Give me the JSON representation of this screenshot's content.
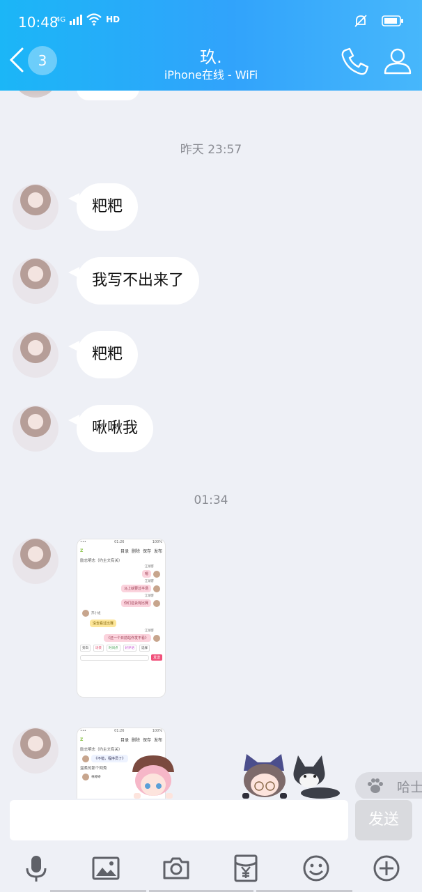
{
  "status_bar": {
    "time": "10:48",
    "network": "4G",
    "hd": "HD"
  },
  "header": {
    "back_badge": "3",
    "title": "玖.",
    "subtitle": "iPhone在线 - WiFi"
  },
  "messages": [
    {
      "timestamp": "昨天 23:57"
    },
    {
      "text": "粑粑"
    },
    {
      "text": "我写不出来了"
    },
    {
      "text": "粑粑"
    },
    {
      "text": "啾啾我"
    },
    {
      "timestamp": "01:34"
    }
  ],
  "screenshot_preview": {
    "status_left": "•••",
    "status_time": "01:26",
    "status_right": "100%",
    "nav_back": "Z",
    "nav_items": [
      "目录",
      "删除",
      "保存",
      "发布"
    ],
    "subtitle": "励志明志（约主文有关）",
    "chat": [
      {
        "side": "right",
        "name": "江湖客",
        "text": "嗯"
      },
      {
        "side": "right",
        "name": "江湖客",
        "text": "马上就要过半场"
      },
      {
        "side": "right",
        "name": "江湖客",
        "text": "你们这会有比赛"
      },
      {
        "side": "left",
        "name": "苏小姐",
        "text": "没去看过比赛"
      },
      {
        "side": "right",
        "name": "江湖客",
        "text": "《还一个日前站作发不看》"
      }
    ],
    "tabs": [
      "旁白",
      "场景",
      "时间点",
      "好评语",
      "选择"
    ],
    "send": "发送"
  },
  "screenshot_preview_2": {
    "subtitle": "励志明志（约主文有关）",
    "line1": "《不错，程序员了》",
    "line2": "温柔的那个阿秀",
    "name": "林婷婷"
  },
  "emoji_suggest": {
    "label": "哈士"
  },
  "input": {
    "value": "",
    "send_label": "发送"
  },
  "toolbar": [
    "microphone-icon",
    "image-icon",
    "camera-icon",
    "red-packet-icon",
    "emoji-icon",
    "plus-icon"
  ],
  "colors": {
    "header_start": "#1bb6f7",
    "header_end": "#47b7fb",
    "background": "#eef0f6",
    "bubble": "#ffffff"
  }
}
